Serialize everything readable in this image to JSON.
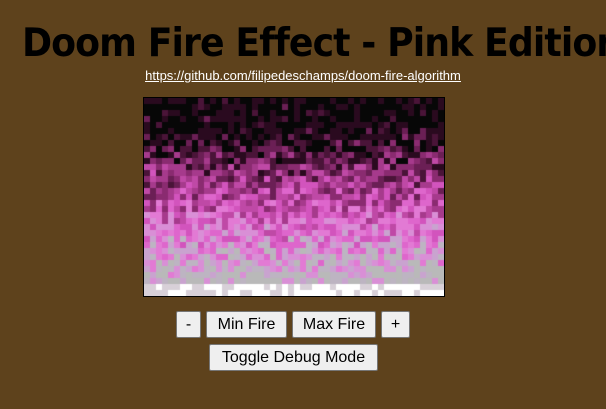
{
  "header": {
    "title": "Doom Fire Effect - Pink Edition",
    "repo_link": "https://github.com/filipedeschamps/doom-fire-algorithm"
  },
  "fire": {
    "palette": [
      "#070707",
      "#2a0a1f",
      "#4a1438",
      "#6b1f55",
      "#8a2b70",
      "#a63a8c",
      "#bf49a6",
      "#d254bd",
      "#de66cc",
      "#e27ad4",
      "#d98fd6",
      "#c9a3cf",
      "#bdb4c2",
      "#b9b9b9",
      "#d8d0d8",
      "#ffffff"
    ]
  },
  "controls": {
    "decrease_label": "-",
    "min_fire_label": "Min Fire",
    "max_fire_label": "Max Fire",
    "increase_label": "+",
    "debug_label": "Toggle Debug Mode"
  }
}
